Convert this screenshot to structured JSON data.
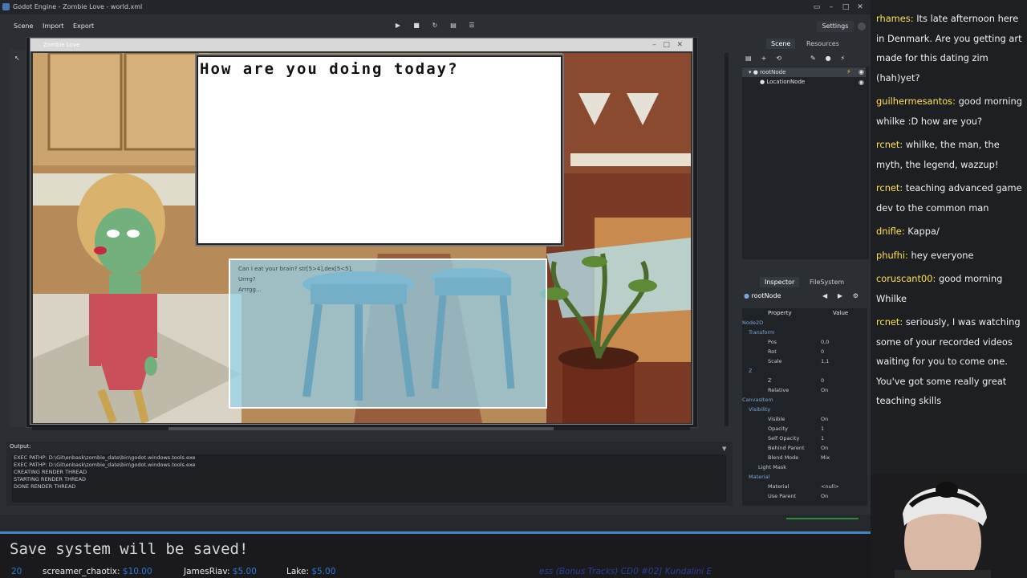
{
  "window": {
    "title": "Godot Engine - Zombie Love - world.xml"
  },
  "menu": {
    "scene": "Scene",
    "import": "Import",
    "export": "Export",
    "settings": "Settings"
  },
  "game_window": {
    "title": "Zombie Love"
  },
  "dialog": {
    "question": "How are you doing today?",
    "options": [
      "Can I eat your brain? str[5>4],dex[5<5],",
      "Urrrg?",
      "Arrrgg..."
    ]
  },
  "output": {
    "label": "Output:",
    "lines": [
      "EXEC PATHP: D:\\Git\\enbask\\zombie_date\\bin\\godot.windows.tools.exe",
      "EXEC PATHP: D:\\Git\\enbask\\zombie_date\\bin\\godot.windows.tools.exe",
      "CREATING RENDER THREAD",
      "STARTING RENDER THREAD",
      "DONE RENDER THREAD"
    ]
  },
  "scene_dock": {
    "tabs": [
      "Scene",
      "Resources"
    ],
    "nodes": [
      "rootNode",
      "LocationNode"
    ]
  },
  "inspector": {
    "tabs": [
      "Inspector",
      "FileSystem"
    ],
    "node": "rootNode",
    "headers": {
      "property": "Property",
      "value": "Value"
    },
    "rows": [
      {
        "k": "Node2D",
        "v": ""
      },
      {
        "k": "Transform",
        "v": ""
      },
      {
        "k": "Pos",
        "v": "0,0"
      },
      {
        "k": "Rot",
        "v": "0"
      },
      {
        "k": "Scale",
        "v": "1,1"
      },
      {
        "k": "Z",
        "v": ""
      },
      {
        "k": "Z",
        "v": "0"
      },
      {
        "k": "Relative",
        "v": "On"
      },
      {
        "k": "CanvasItem",
        "v": ""
      },
      {
        "k": "Visibility",
        "v": ""
      },
      {
        "k": "Visible",
        "v": "On"
      },
      {
        "k": "Opacity",
        "v": "1"
      },
      {
        "k": "Self Opacity",
        "v": "1"
      },
      {
        "k": "Behind Parent",
        "v": "On"
      },
      {
        "k": "Blend Mode",
        "v": "Mix"
      },
      {
        "k": "Light Mask",
        "v": ""
      },
      {
        "k": "Material",
        "v": ""
      },
      {
        "k": "Material",
        "v": "<null>"
      },
      {
        "k": "Use Parent",
        "v": "On"
      }
    ]
  },
  "chat": [
    {
      "user": "rhames",
      "text": "Its late afternoon here in Denmark. Are you getting art made for this dating zim (hah)yet?"
    },
    {
      "user": "guilhermesantos",
      "text": "good morning whilke :D how are you?"
    },
    {
      "user": "rcnet",
      "text": "whilke, the man, the myth, the legend, wazzup!"
    },
    {
      "user": "rcnet",
      "text": "teaching advanced game dev to the common man"
    },
    {
      "user": "dnifle",
      "text": "Kappa/"
    },
    {
      "user": "phufhi",
      "text": "hey everyone"
    },
    {
      "user": "coruscant00",
      "text": "good morning Whilke"
    },
    {
      "user": "rcnet",
      "text": "seriously, I was watching some of your recorded videos waiting for you to come one. You've got some really great teaching skills"
    }
  ],
  "overlay": {
    "save_text": "Save system will be saved!",
    "tips": [
      {
        "name": "20",
        "amount": ""
      },
      {
        "name": "screamer_chaotix:",
        "amount": "$10.00"
      },
      {
        "name": "JamesRiav:",
        "amount": "$5.00"
      },
      {
        "name": "Lake:",
        "amount": "$5.00"
      }
    ],
    "ticker": "ess (Bonus Tracks) CD0 #02] Kundalini E"
  }
}
